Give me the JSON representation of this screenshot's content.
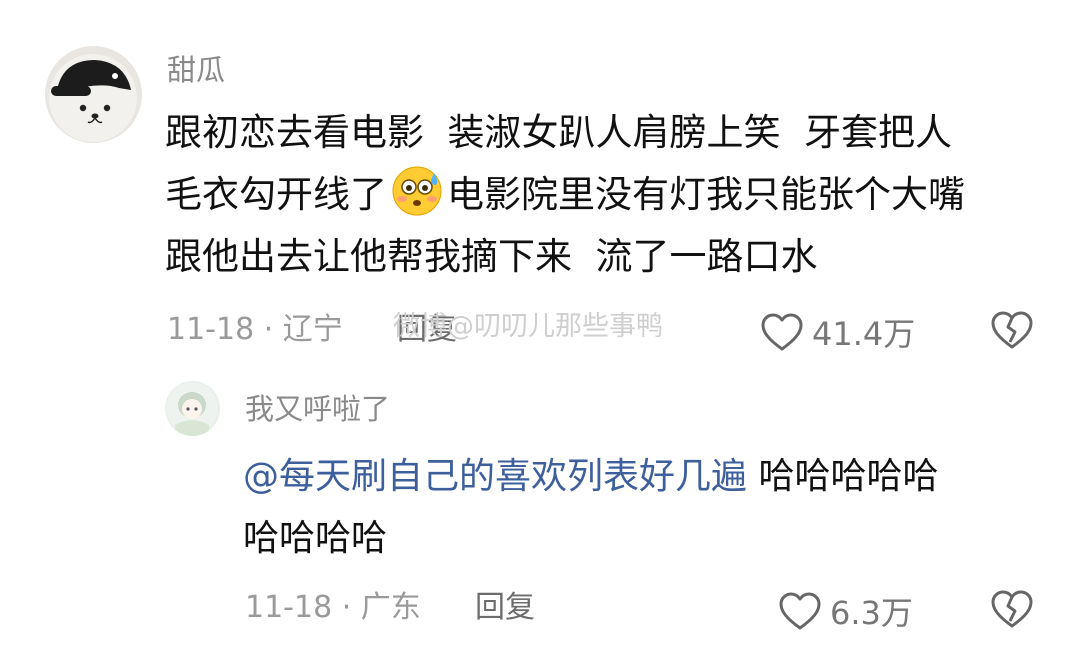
{
  "comment": {
    "avatar_icon": "bear-with-black-cap-avatar",
    "username": "甜瓜",
    "line1": "跟初恋去看电影  装淑女趴人肩膀上笑  牙套把人",
    "line2_a": "毛衣勾开线了",
    "emoji": "flushed-sweat-face-emoji",
    "line2_b": "电影院里没有灯我只能张个大嘴",
    "line3": "跟他出去让他帮我摘下来  流了一路口水",
    "date_location": "11-18 · 辽宁",
    "reply_label": "回复",
    "likes": "41.4万"
  },
  "watermark": "微博@叨叨儿那些事鸭",
  "reply": {
    "avatar_icon": "anime-girl-avatar",
    "username": "我又呼啦了",
    "mention": "@每天刷自己的喜欢列表好几遍",
    "text_a": " 哈哈哈哈哈",
    "text_b": "哈哈哈哈",
    "date_location": "11-18 · 广东",
    "reply_label": "回复",
    "likes": "6.3万"
  },
  "colors": {
    "mention": "#3d5f9c",
    "meta": "#9a9a9a",
    "text": "#111111"
  }
}
